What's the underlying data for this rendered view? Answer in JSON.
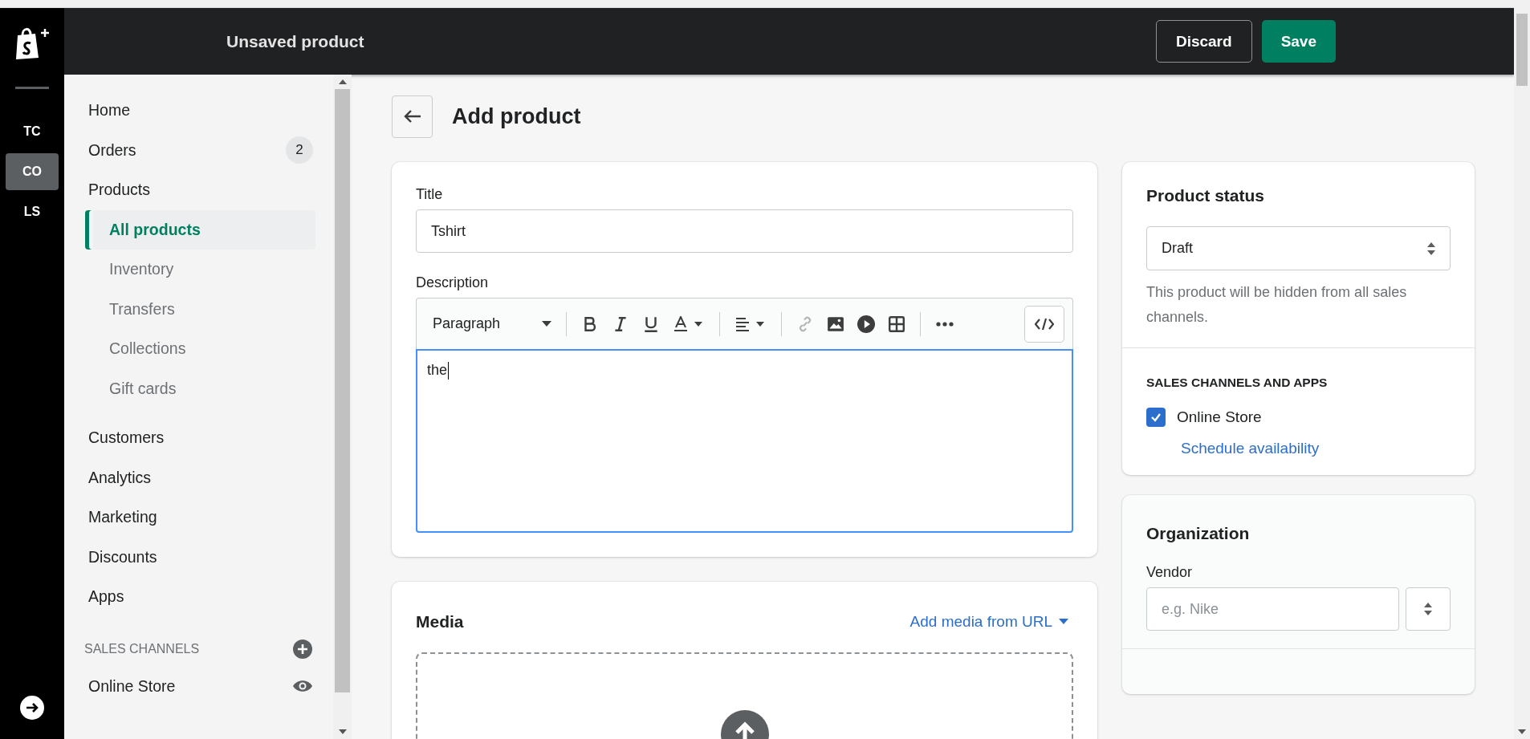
{
  "rail": {
    "items": [
      {
        "label": "TC",
        "selected": false
      },
      {
        "label": "CO",
        "selected": true
      },
      {
        "label": "LS",
        "selected": false
      }
    ]
  },
  "topbar": {
    "title": "Unsaved product",
    "buttons": [
      {
        "label": "Discard",
        "kind": "secondary"
      },
      {
        "label": "Save",
        "kind": "primary"
      }
    ]
  },
  "sidebar": {
    "items": [
      {
        "label": "Home",
        "selected": false
      },
      {
        "label": "Orders",
        "badge": "2",
        "selected": false
      },
      {
        "label": "Products",
        "selected": false,
        "children": [
          {
            "label": "All products",
            "selected": true
          },
          {
            "label": "Inventory",
            "selected": false
          },
          {
            "label": "Transfers",
            "selected": false
          },
          {
            "label": "Collections",
            "selected": false
          },
          {
            "label": "Gift cards",
            "selected": false
          }
        ]
      },
      {
        "label": "Customers",
        "selected": false
      },
      {
        "label": "Analytics",
        "selected": false
      },
      {
        "label": "Marketing",
        "selected": false
      },
      {
        "label": "Discounts",
        "selected": false
      },
      {
        "label": "Apps",
        "selected": false
      }
    ],
    "sales_channels": {
      "heading": "SALES CHANNELS",
      "items": [
        {
          "label": "Online Store",
          "selected": false
        }
      ]
    }
  },
  "page": {
    "title": "Add product"
  },
  "product_card": {
    "title_label": "Title",
    "title_value": "Tshirt",
    "description_label": "Description",
    "format": "Paragraph",
    "description_value": "the"
  },
  "media": {
    "heading": "Media",
    "link": "Add media from URL"
  },
  "status_card": {
    "heading": "Product status",
    "status": "Draft",
    "help": "This product will be hidden from all sales channels.",
    "channels_heading": "SALES CHANNELS AND APPS",
    "channels": [
      {
        "label": "Online Store",
        "checked": true
      }
    ],
    "schedule_link": "Schedule availability"
  },
  "organization": {
    "heading": "Organization",
    "vendor_label": "Vendor",
    "vendor_placeholder": "e.g. Nike"
  }
}
